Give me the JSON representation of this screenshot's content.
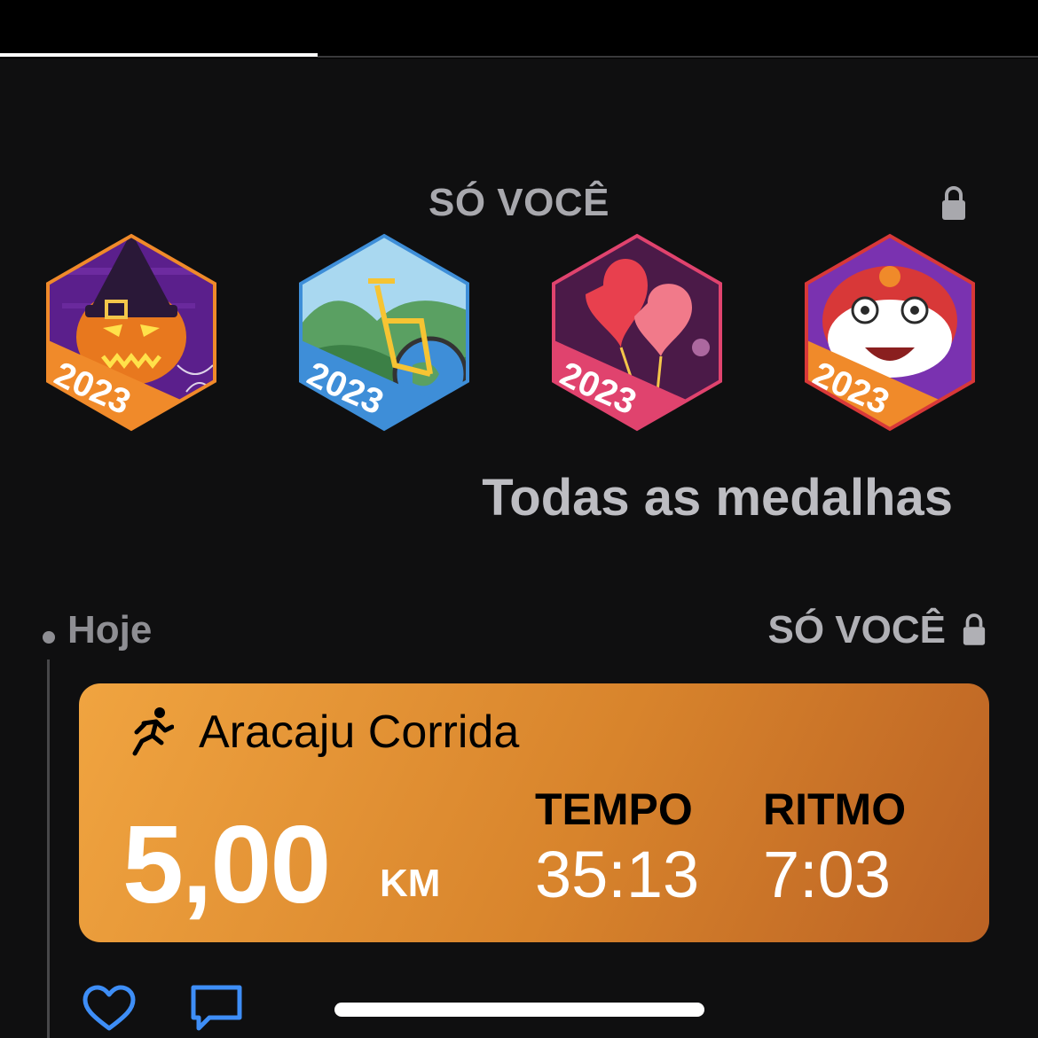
{
  "tabs": {
    "active_index": 0
  },
  "trophy_section": {
    "privacy_label": "SÓ VOCÊ",
    "medals": [
      {
        "name": "halloween-2023-medal",
        "year": "2023"
      },
      {
        "name": "bike-2023-medal",
        "year": "2023"
      },
      {
        "name": "valentines-2023-medal",
        "year": "2023"
      },
      {
        "name": "lunar-new-year-2023-medal",
        "year": "2023"
      }
    ],
    "all_medals_link": "Todas as medalhas"
  },
  "feed": {
    "date_label": "Hoje",
    "privacy_label": "SÓ VOCÊ",
    "activity": {
      "title": "Aracaju Corrida",
      "distance": "5,00",
      "distance_unit": "KM",
      "time_label": "TEMPO",
      "time_value": "35:13",
      "pace_label": "RITMO",
      "pace_value": "7:03",
      "colors": {
        "gradient_start": "#f0a440",
        "gradient_end": "#bb6224"
      }
    }
  },
  "colors": {
    "background": "#0f0f10",
    "link_blue": "#3e8ef7"
  }
}
